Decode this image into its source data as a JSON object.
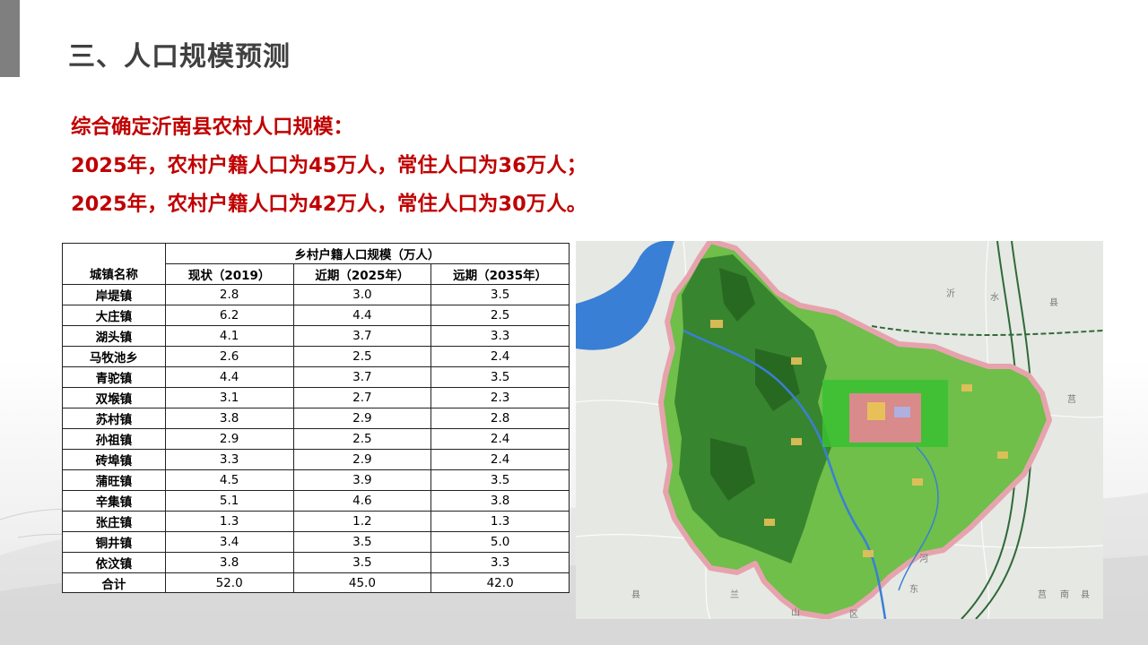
{
  "slide": {
    "title": "三、人口规模预测"
  },
  "summary": {
    "line1": "综合确定沂南县农村人口规模：",
    "line2": "2025年，农村户籍人口为45万人，常住人口为36万人；",
    "line3": "2025年，农村户籍人口为42万人，常住人口为30万人。"
  },
  "table": {
    "group_header": "乡村户籍人口规模（万人）",
    "name_header": "城镇名称",
    "col_current": "现状（2019）",
    "col_near": "近期（2025年）",
    "col_far": "远期（2035年）",
    "rows": [
      {
        "name": "岸堤镇",
        "current": "2.8",
        "near": "3.0",
        "far": "3.5"
      },
      {
        "name": "大庄镇",
        "current": "6.2",
        "near": "4.4",
        "far": "2.5"
      },
      {
        "name": "湖头镇",
        "current": "4.1",
        "near": "3.7",
        "far": "3.3"
      },
      {
        "name": "马牧池乡",
        "current": "2.6",
        "near": "2.5",
        "far": "2.4"
      },
      {
        "name": "青驼镇",
        "current": "4.4",
        "near": "3.7",
        "far": "3.5"
      },
      {
        "name": "双堠镇",
        "current": "3.1",
        "near": "2.7",
        "far": "2.3"
      },
      {
        "name": "苏村镇",
        "current": "3.8",
        "near": "2.9",
        "far": "2.8"
      },
      {
        "name": "孙祖镇",
        "current": "2.9",
        "near": "2.5",
        "far": "2.4"
      },
      {
        "name": "砖埠镇",
        "current": "3.3",
        "near": "2.9",
        "far": "2.4"
      },
      {
        "name": "蒲旺镇",
        "current": "4.5",
        "near": "3.9",
        "far": "3.5"
      },
      {
        "name": "辛集镇",
        "current": "5.1",
        "near": "4.6",
        "far": "3.8"
      },
      {
        "name": "张庄镇",
        "current": "1.3",
        "near": "1.2",
        "far": "1.3"
      },
      {
        "name": "铜井镇",
        "current": "3.4",
        "near": "3.5",
        "far": "5.0"
      },
      {
        "name": "依汶镇",
        "current": "3.8",
        "near": "3.5",
        "far": "3.3"
      }
    ],
    "total": {
      "name": "合计",
      "current": "52.0",
      "near": "45.0",
      "far": "42.0"
    }
  },
  "map": {
    "labels": {
      "yi": "沂",
      "shui": "水",
      "xian_top": "县",
      "ju": "莒",
      "he": "河",
      "dong": "东",
      "ju2": "莒",
      "nan": "南",
      "xian_br": "县",
      "xian_bl": "县",
      "lan": "兰",
      "shan": "山",
      "qu": "区"
    },
    "colors": {
      "county_fill": "#6fbf4a",
      "mountain": "#2f7a2a",
      "water": "#3a7fd6",
      "urban": "#d98a8a",
      "boundary": "#e7a3ad",
      "outside": "#e6e8e3"
    }
  }
}
